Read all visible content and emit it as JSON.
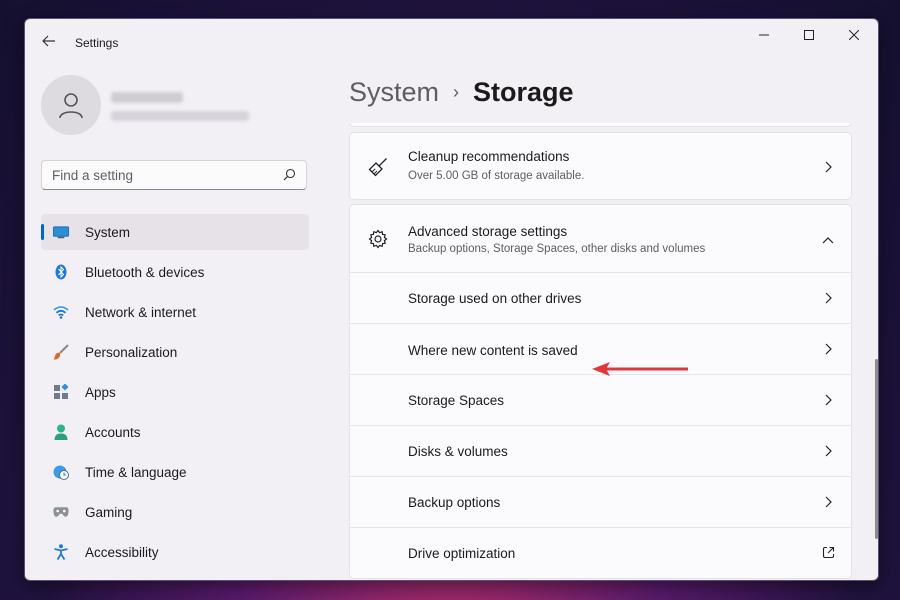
{
  "window": {
    "title": "Settings",
    "back_icon": "back-arrow-icon",
    "minimize_icon": "minimize-icon",
    "maximize_icon": "maximize-icon",
    "close_icon": "close-icon"
  },
  "profile": {
    "avatar_icon": "person-icon"
  },
  "search": {
    "placeholder": "Find a setting",
    "icon": "search-icon"
  },
  "nav": {
    "items": [
      {
        "label": "System",
        "icon": "monitor-icon",
        "active": true
      },
      {
        "label": "Bluetooth & devices",
        "icon": "bluetooth-icon"
      },
      {
        "label": "Network & internet",
        "icon": "wifi-icon"
      },
      {
        "label": "Personalization",
        "icon": "brush-icon"
      },
      {
        "label": "Apps",
        "icon": "apps-icon"
      },
      {
        "label": "Accounts",
        "icon": "account-icon"
      },
      {
        "label": "Time & language",
        "icon": "globe-clock-icon"
      },
      {
        "label": "Gaming",
        "icon": "gamepad-icon"
      },
      {
        "label": "Accessibility",
        "icon": "accessibility-icon"
      }
    ]
  },
  "breadcrumb": {
    "parent": "System",
    "separator": "›",
    "current": "Storage"
  },
  "cleanup": {
    "title": "Cleanup recommendations",
    "description": "Over 5.00 GB of storage available.",
    "icon": "broom-icon"
  },
  "advanced": {
    "title": "Advanced storage settings",
    "description": "Backup options, Storage Spaces, other disks and volumes",
    "icon": "gear-icon",
    "expanded": true,
    "items": [
      {
        "label": "Storage used on other drives",
        "action_icon": "chevron-right-icon"
      },
      {
        "label": "Where new content is saved",
        "action_icon": "chevron-right-icon",
        "highlighted": true
      },
      {
        "label": "Storage Spaces",
        "action_icon": "chevron-right-icon"
      },
      {
        "label": "Disks & volumes",
        "action_icon": "chevron-right-icon"
      },
      {
        "label": "Backup options",
        "action_icon": "chevron-right-icon"
      },
      {
        "label": "Drive optimization",
        "action_icon": "external-link-icon"
      }
    ]
  },
  "colors": {
    "accent": "#0067c0",
    "annotation_arrow": "#e0383b"
  }
}
